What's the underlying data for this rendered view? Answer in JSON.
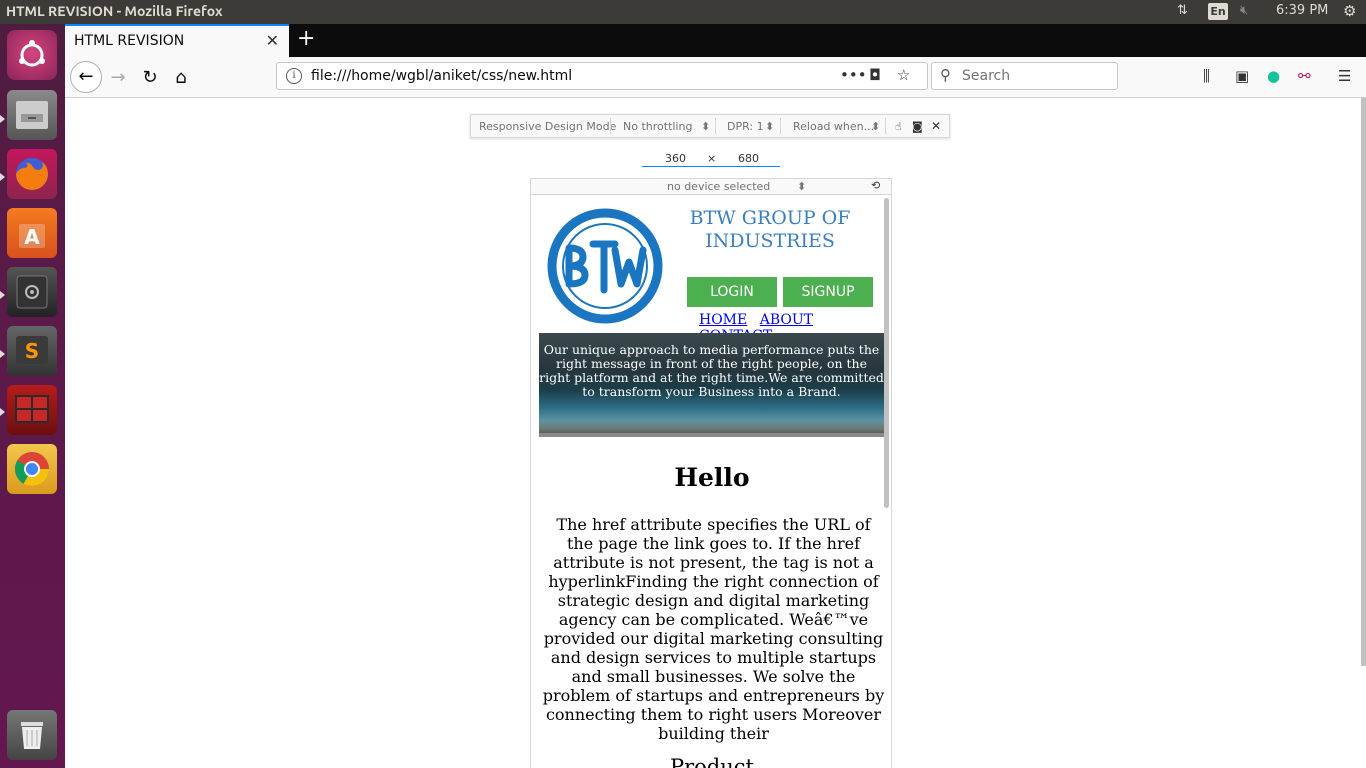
{
  "window": {
    "title": "HTML REVISION - Mozilla Firefox"
  },
  "system": {
    "lang": "En",
    "time": "6:39 PM"
  },
  "tab": {
    "title": "HTML REVISION"
  },
  "nav": {
    "url": "file:///home/wgbl/aniket/css/new.html",
    "search_placeholder": "Search"
  },
  "rdm": {
    "mode_label": "Responsive Design Mode",
    "throttle": "No throttling",
    "dpr": "DPR: 1",
    "reload": "Reload when...",
    "width": "360",
    "times": "×",
    "height": "680",
    "device": "no device selected"
  },
  "site": {
    "brand": "BTW GROUP OF INDUSTRIES",
    "logo_text": "BTW",
    "login": "LOGIN",
    "signup": "SIGNUP",
    "nav": [
      "HOME",
      "ABOUT",
      "CONTACT"
    ],
    "hero_text": "Our unique approach to media performance puts the right message in front of the right people, on the right platform and at the right time.We are committed to transform your Business into a Brand.",
    "heading": "Hello",
    "paragraph": "The href attribute specifies the URL of the page the link goes to. If the href attribute is not present, the tag is not a hyperlinkFinding the right connection of strategic design and digital marketing agency can be complicated. Weâ€™ve provided our digital marketing consulting and design services to multiple startups and small businesses. We solve the problem of startups and entrepreneurs by connecting them to right users Moreover building their",
    "next_heading": "Product"
  }
}
